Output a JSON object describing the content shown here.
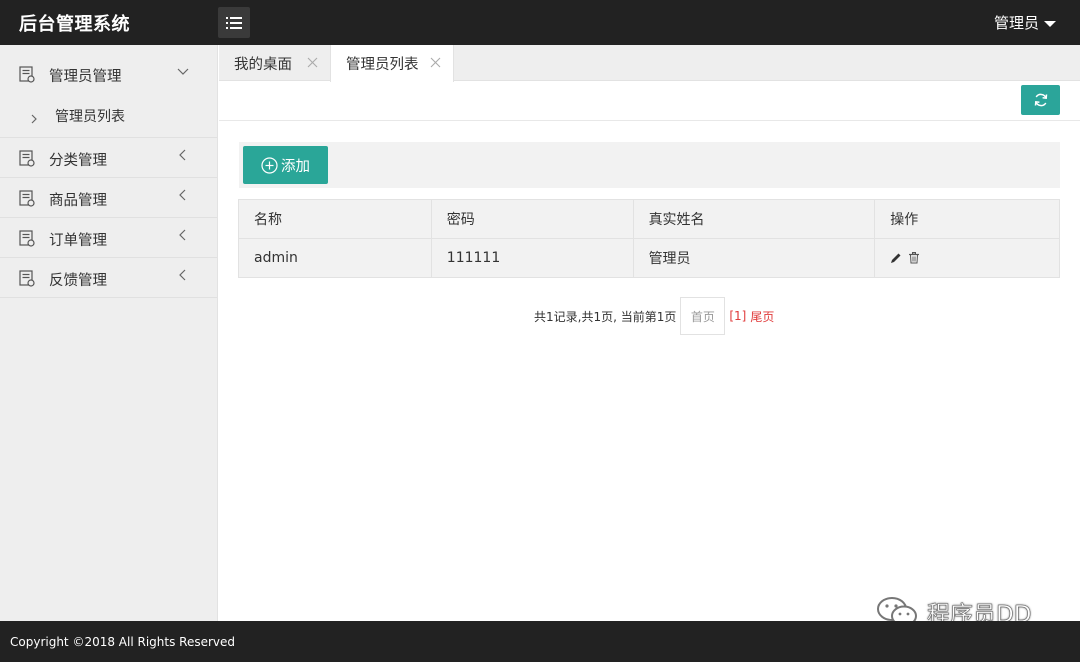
{
  "header": {
    "logo": "后台管理系统",
    "user": "管理员"
  },
  "sidebar": {
    "items": [
      {
        "label": "管理员管理",
        "open": true,
        "children": [
          {
            "label": "管理员列表"
          }
        ]
      },
      {
        "label": "分类管理"
      },
      {
        "label": "商品管理"
      },
      {
        "label": "订单管理"
      },
      {
        "label": "反馈管理"
      }
    ]
  },
  "tabs": [
    {
      "label": "我的桌面",
      "active": false
    },
    {
      "label": "管理员列表",
      "active": true
    }
  ],
  "actions": {
    "add_label": "添加"
  },
  "table": {
    "columns": [
      "名称",
      "密码",
      "真实姓名",
      "操作"
    ],
    "rows": [
      {
        "name": "admin",
        "password": "111111",
        "real_name": "管理员"
      }
    ]
  },
  "pagination": {
    "summary": "共1记录,共1页, 当前第1页",
    "first": "首页",
    "current": "[1]",
    "last": "尾页"
  },
  "footer": {
    "copyright": "Copyright ©2018 All Rights Reserved"
  },
  "watermark": {
    "text": "程序员DD"
  },
  "colors": {
    "header_bg": "#222222",
    "accent": "#2aa698",
    "link_red": "#e03a3a"
  }
}
